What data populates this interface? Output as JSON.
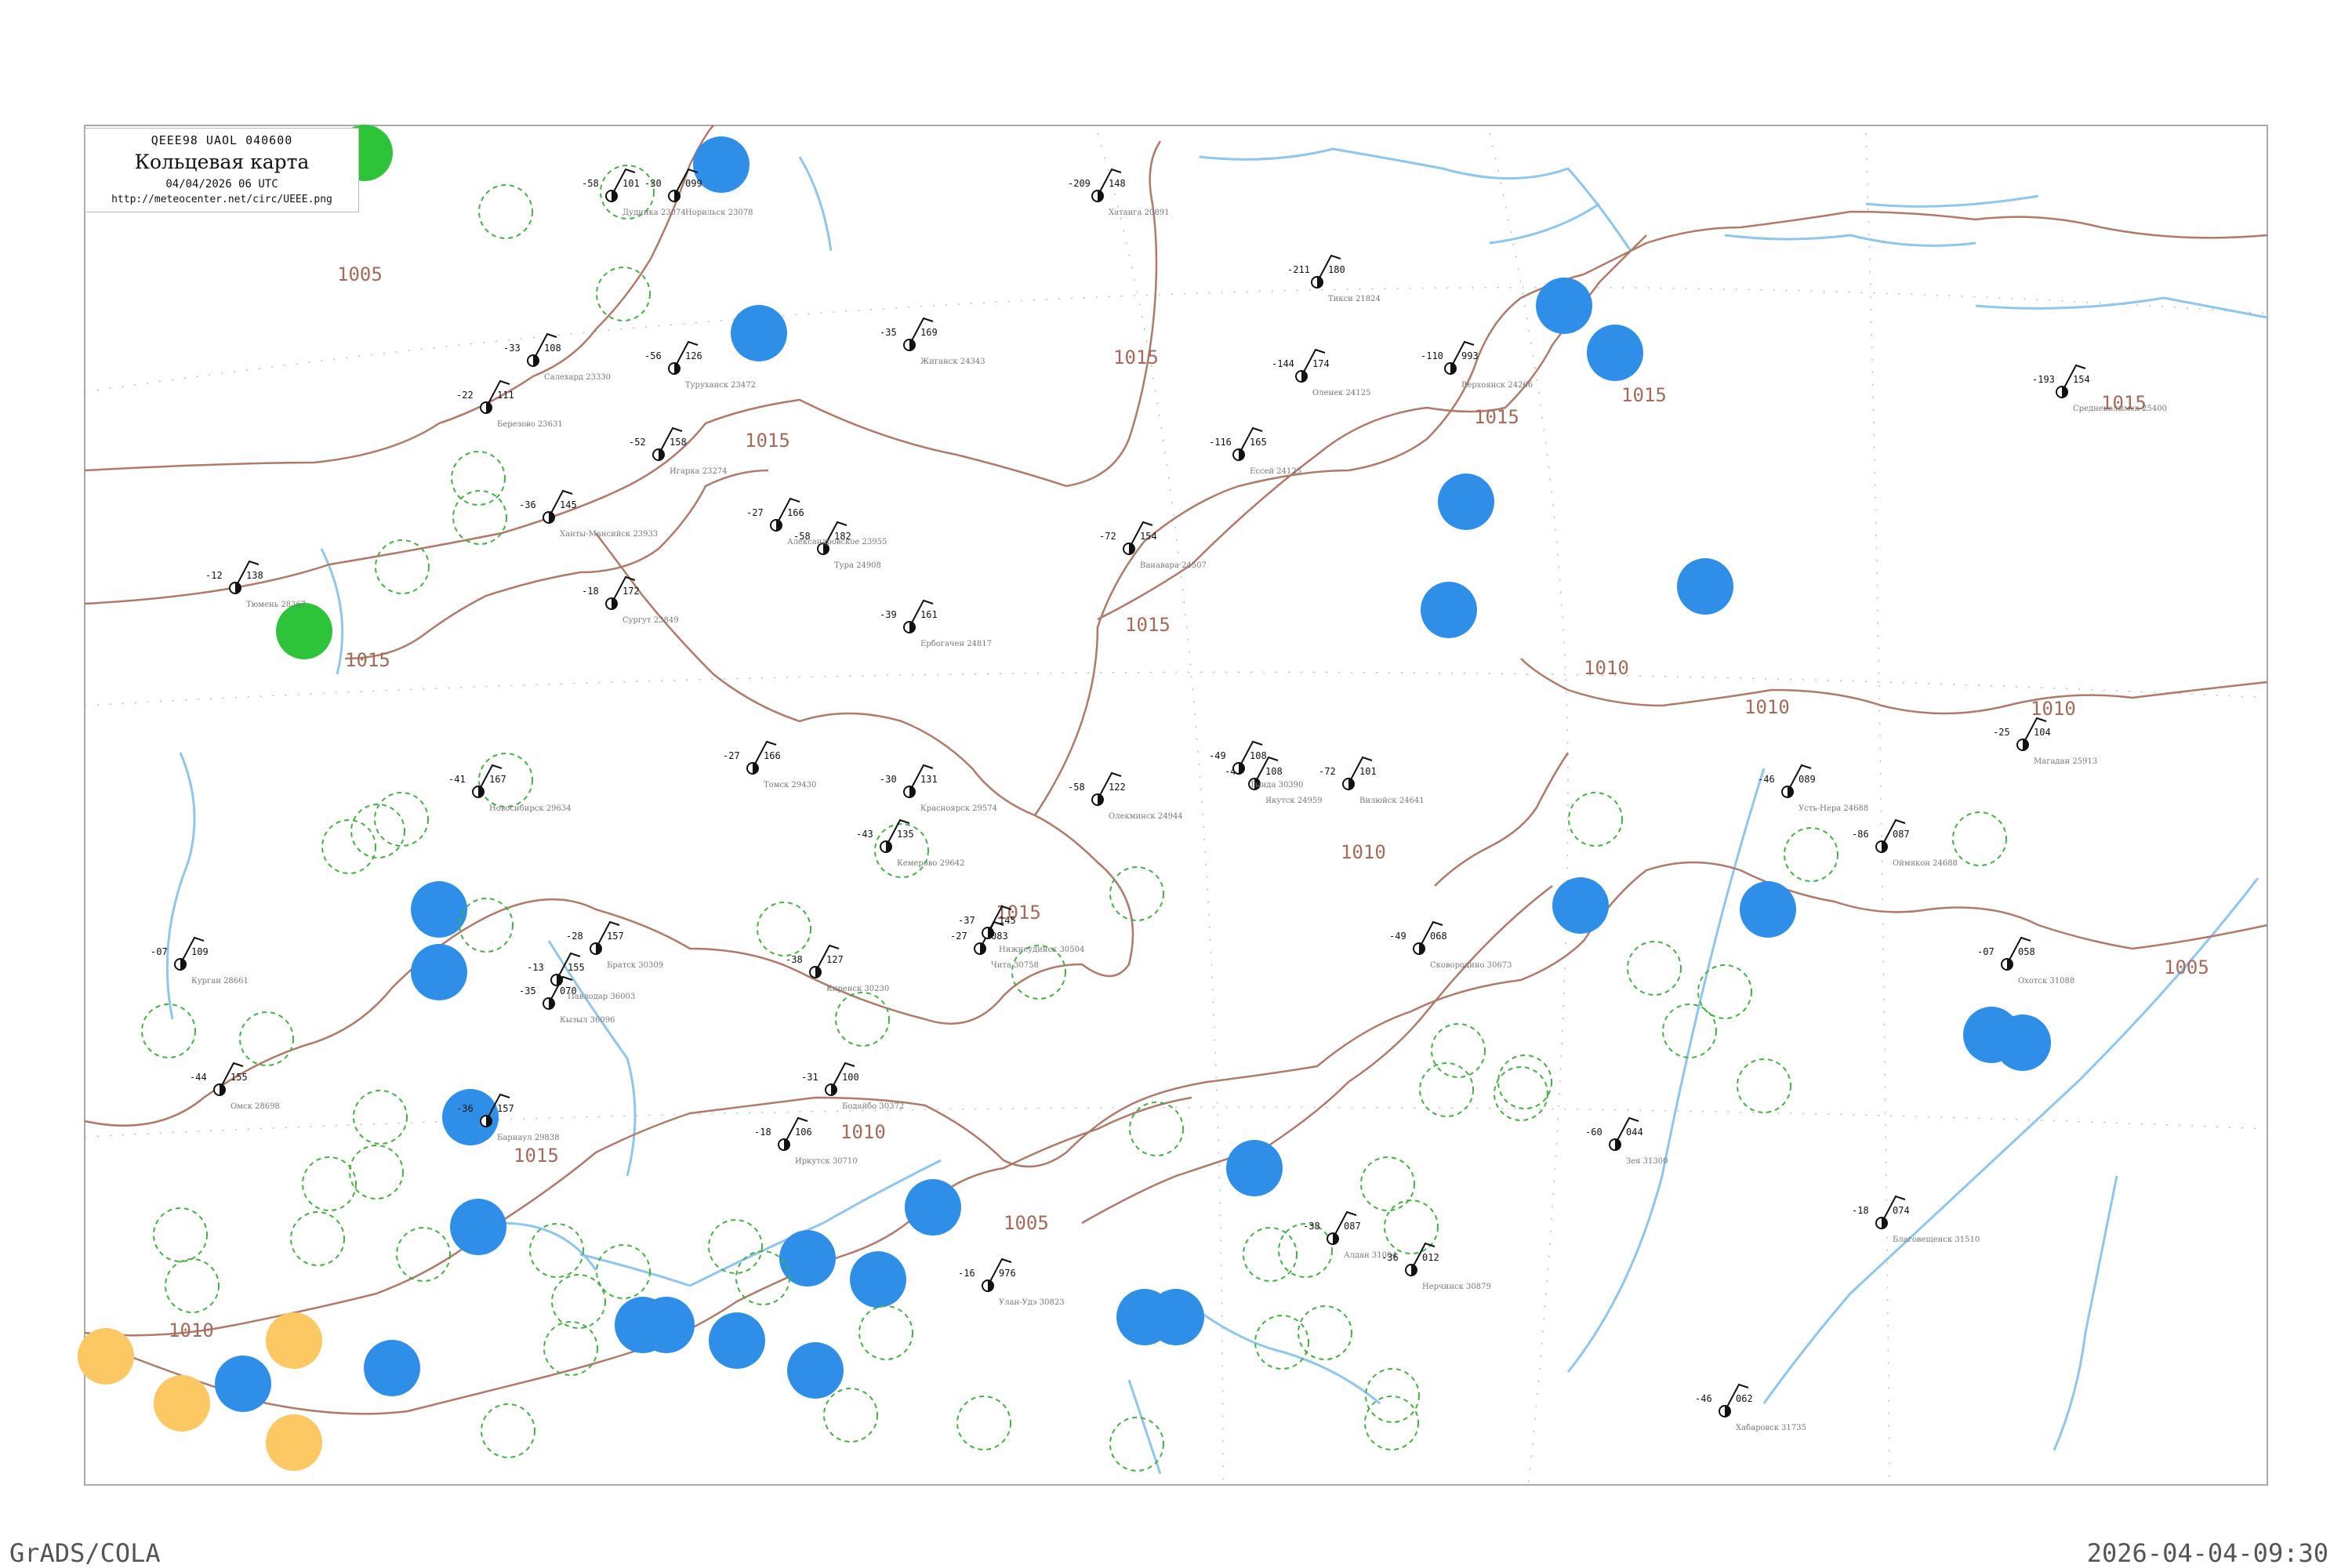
{
  "legend": {
    "code": "QEEE98  UAOL  040600",
    "title": "Кольцевая карта",
    "date": "04/04/2026 06 UTC",
    "url": "http://meteocenter.net/circ/UEEE.png"
  },
  "footer": {
    "left": "GrADS/COLA",
    "right": "2026-04-04-09:30"
  },
  "isobar_labels": [
    "1005",
    "1010",
    "1015"
  ],
  "colors": {
    "isobar": "#b07a6a",
    "river": "#8fc6ee",
    "station_blue": "#2f8ee8",
    "station_green": "#2ec43a",
    "station_orange": "#fcc863",
    "ring_dashed": "#46b046"
  },
  "stations": [
    {
      "label": "Дудинка 23074",
      "t": "-58",
      "p": "101"
    },
    {
      "label": "Туруханск 23472",
      "t": "-56",
      "p": "126"
    },
    {
      "label": "Ванавара 24507",
      "t": "-72",
      "p": "154"
    },
    {
      "label": "Тура 24908",
      "t": "-58",
      "p": "182"
    },
    {
      "label": "Ербогачен 24817",
      "t": "-39",
      "p": "161"
    },
    {
      "label": "Вилюйск 24641",
      "t": "-72",
      "p": "101"
    },
    {
      "label": "Якутск 24959",
      "t": "-49",
      "p": "108"
    },
    {
      "label": "Оймякон 24688",
      "t": "-86",
      "p": "087"
    },
    {
      "label": "Верхоянск 24266",
      "t": "-110",
      "p": "993"
    },
    {
      "label": "Тикси 21824",
      "t": "-211",
      "p": "180"
    },
    {
      "label": "Хатанга 20891",
      "t": "-209",
      "p": "148"
    },
    {
      "label": "Олекминск 24944",
      "t": "-58",
      "p": "122"
    },
    {
      "label": "Алдан 31004",
      "t": "-38",
      "p": "087"
    },
    {
      "label": "Чита 30758",
      "t": "-27",
      "p": "083"
    },
    {
      "label": "Иркутск 30710",
      "t": "-18",
      "p": "106"
    },
    {
      "label": "Улан-Удэ 30823",
      "t": "-16",
      "p": "976"
    },
    {
      "label": "Благовещенск 31510",
      "t": "-18",
      "p": "074"
    },
    {
      "label": "Хабаровск 31735",
      "t": "-46",
      "p": "062"
    },
    {
      "label": "Магадан 25913",
      "t": "-25",
      "p": "104"
    },
    {
      "label": "Охотск 31088",
      "t": "-07",
      "p": "058"
    },
    {
      "label": "Новосибирск 29634",
      "t": "-41",
      "p": "167"
    },
    {
      "label": "Томск 29430",
      "t": "-27",
      "p": "166"
    },
    {
      "label": "Барнаул 29838",
      "t": "-36",
      "p": "157"
    },
    {
      "label": "Красноярск 29574",
      "t": "-30",
      "p": "131"
    },
    {
      "label": "Омск 28698",
      "t": "-44",
      "p": "155"
    },
    {
      "label": "Тюмень 28367",
      "t": "-12",
      "p": "138"
    },
    {
      "label": "Салехард 23330",
      "t": "-33",
      "p": "108"
    },
    {
      "label": "Березово 23631",
      "t": "-22",
      "p": "111"
    },
    {
      "label": "Ханты-Мансийск 23933",
      "t": "-36",
      "p": "145"
    },
    {
      "label": "Сургут 23849",
      "t": "-18",
      "p": "172"
    },
    {
      "label": "Александровское 23955",
      "t": "-27",
      "p": "166"
    },
    {
      "label": "Кызыл 36096",
      "t": "-35",
      "p": "070"
    },
    {
      "label": "Нерчинск 30879",
      "t": "-36",
      "p": "012"
    },
    {
      "label": "Сковородино 30673",
      "t": "-49",
      "p": "068"
    },
    {
      "label": "Норильск 23078",
      "t": "-30",
      "p": "099"
    },
    {
      "label": "Игарка 23274",
      "t": "-52",
      "p": "158"
    },
    {
      "label": "Ессей 24125",
      "t": "-116",
      "p": "165"
    },
    {
      "label": "Оленек 24125",
      "t": "-144",
      "p": "174"
    },
    {
      "label": "Жиганск 24343",
      "t": "-35",
      "p": "169"
    },
    {
      "label": "Среднеколымск 25400",
      "t": "-193",
      "p": "154"
    },
    {
      "label": "Усть-Нера 24688",
      "t": "-46",
      "p": "089"
    },
    {
      "label": "Зея 31300",
      "t": "-60",
      "p": "044"
    },
    {
      "label": "Тында 30390",
      "t": "-49",
      "p": "108"
    },
    {
      "label": "Бодайбо 30372",
      "t": "-31",
      "p": "100"
    },
    {
      "label": "Киренск 30230",
      "t": "-38",
      "p": "127"
    },
    {
      "label": "Братск 30309",
      "t": "-28",
      "p": "157"
    },
    {
      "label": "Кемерово 29642",
      "t": "-43",
      "p": "135"
    },
    {
      "label": "Павлодар 36003",
      "t": "-13",
      "p": "155"
    },
    {
      "label": "Курган 28661",
      "t": "-07",
      "p": "109"
    },
    {
      "label": "Нижнеудинск 30504",
      "t": "-37",
      "p": "145"
    }
  ]
}
